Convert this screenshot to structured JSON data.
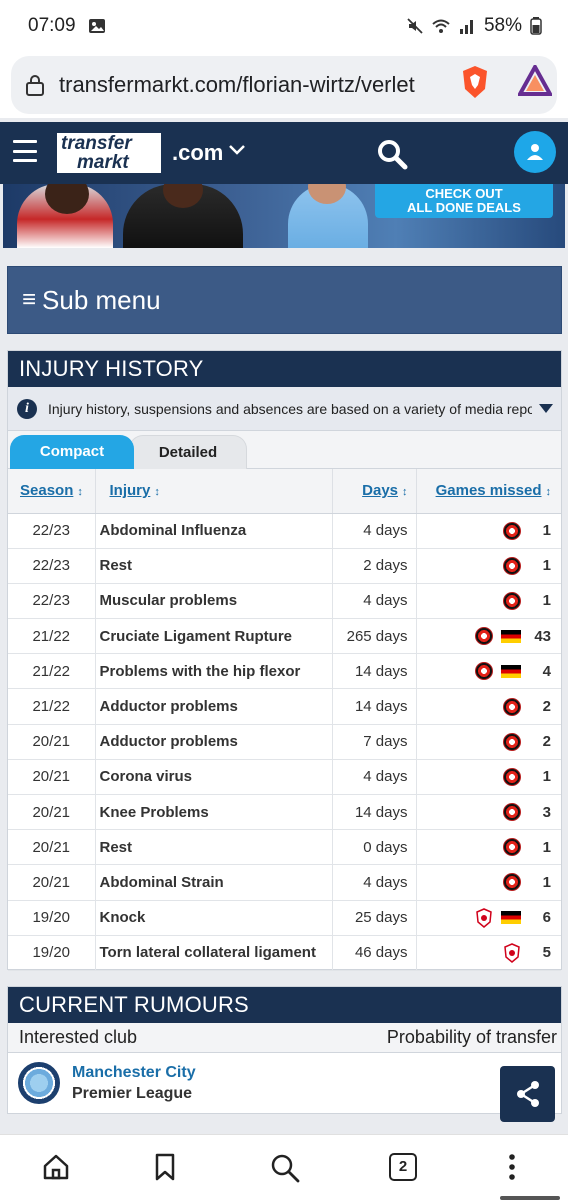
{
  "status_bar": {
    "time": "07:09",
    "battery": "58%"
  },
  "browser": {
    "url": "transfermarkt.com/florian-wirtz/verlet",
    "tab_count": "2"
  },
  "site_header": {
    "logo_line1": "transfer",
    "logo_line2": "markt",
    "domain": ".com"
  },
  "banner": {
    "cta_line1": "CHECK OUT",
    "cta_line2": "ALL DONE DEALS"
  },
  "submenu": {
    "icon": "≡",
    "label": "Sub menu"
  },
  "injury_history": {
    "title": "INJURY HISTORY",
    "info": "Injury history, suspensions and absences are based on a variety of media repor...",
    "tabs": [
      "Compact",
      "Detailed"
    ],
    "columns": [
      "Season",
      "Injury",
      "Days",
      "Games missed"
    ],
    "rows": [
      {
        "season": "22/23",
        "injury": "Abdominal Influenza",
        "days": "4 days",
        "clubs": [
          "leverkusen"
        ],
        "games": "1"
      },
      {
        "season": "22/23",
        "injury": "Rest",
        "days": "2 days",
        "clubs": [
          "leverkusen"
        ],
        "games": "1"
      },
      {
        "season": "22/23",
        "injury": "Muscular problems",
        "days": "4 days",
        "clubs": [
          "leverkusen"
        ],
        "games": "1"
      },
      {
        "season": "21/22",
        "injury": "Cruciate Ligament Rupture",
        "days": "265 days",
        "clubs": [
          "leverkusen",
          "germany"
        ],
        "games": "43"
      },
      {
        "season": "21/22",
        "injury": "Problems with the hip flexor",
        "days": "14 days",
        "clubs": [
          "leverkusen",
          "germany"
        ],
        "games": "4"
      },
      {
        "season": "21/22",
        "injury": "Adductor problems",
        "days": "14 days",
        "clubs": [
          "leverkusen"
        ],
        "games": "2"
      },
      {
        "season": "20/21",
        "injury": "Adductor problems",
        "days": "7 days",
        "clubs": [
          "leverkusen"
        ],
        "games": "2"
      },
      {
        "season": "20/21",
        "injury": "Corona virus",
        "days": "4 days",
        "clubs": [
          "leverkusen"
        ],
        "games": "1"
      },
      {
        "season": "20/21",
        "injury": "Knee Problems",
        "days": "14 days",
        "clubs": [
          "leverkusen"
        ],
        "games": "3"
      },
      {
        "season": "20/21",
        "injury": "Rest",
        "days": "0 days",
        "clubs": [
          "leverkusen"
        ],
        "games": "1"
      },
      {
        "season": "20/21",
        "injury": "Abdominal Strain",
        "days": "4 days",
        "clubs": [
          "leverkusen"
        ],
        "games": "1"
      },
      {
        "season": "19/20",
        "injury": "Knock",
        "days": "25 days",
        "clubs": [
          "koln",
          "germany"
        ],
        "games": "6"
      },
      {
        "season": "19/20",
        "injury": "Torn lateral collateral ligament",
        "days": "46 days",
        "clubs": [
          "koln"
        ],
        "games": "5"
      }
    ]
  },
  "rumours": {
    "title": "CURRENT RUMOURS",
    "col_club": "Interested club",
    "col_prob": "Probability of transfer",
    "club": "Manchester City",
    "league": "Premier League"
  },
  "colors": {
    "header": "#1a3151",
    "accent": "#24a6e4",
    "link": "#1a6ea8"
  }
}
